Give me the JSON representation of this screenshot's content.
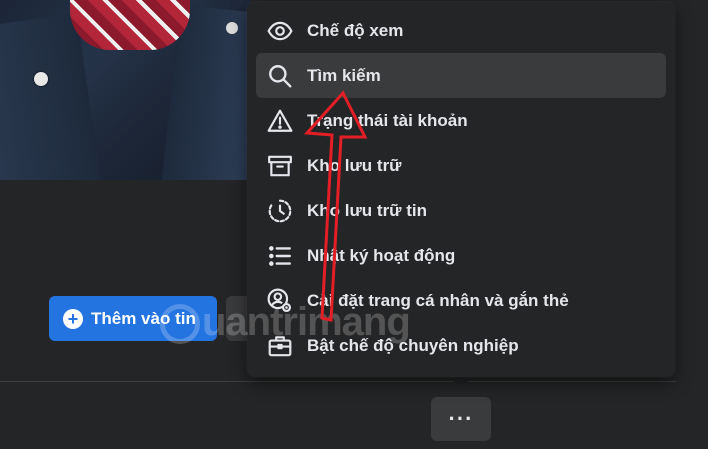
{
  "menu": {
    "items": [
      {
        "label": "Chế độ xem",
        "icon": "eye-icon"
      },
      {
        "label": "Tìm kiếm",
        "icon": "search-icon",
        "highlighted": true
      },
      {
        "label": "Trạng thái tài khoản",
        "icon": "warning-icon"
      },
      {
        "label": "Kho lưu trữ",
        "icon": "archive-icon"
      },
      {
        "label": "Kho lưu trữ tin",
        "icon": "story-archive-icon"
      },
      {
        "label": "Nhật ký hoạt động",
        "icon": "activity-list-icon"
      },
      {
        "label": "Cài đặt trang cá nhân và gắn thẻ",
        "icon": "profile-settings-icon"
      },
      {
        "label": "Bật chế độ chuyên nghiệp",
        "icon": "briefcase-icon"
      }
    ]
  },
  "profile_actions": {
    "add_story_label": "Thêm vào tin",
    "more_label": "···"
  },
  "watermark": {
    "text": "uantrimang"
  },
  "colors": {
    "background": "#242526",
    "menu_hover": "#3a3b3c",
    "primary_button": "#2374e1",
    "annotation_arrow": "#e41e26"
  }
}
